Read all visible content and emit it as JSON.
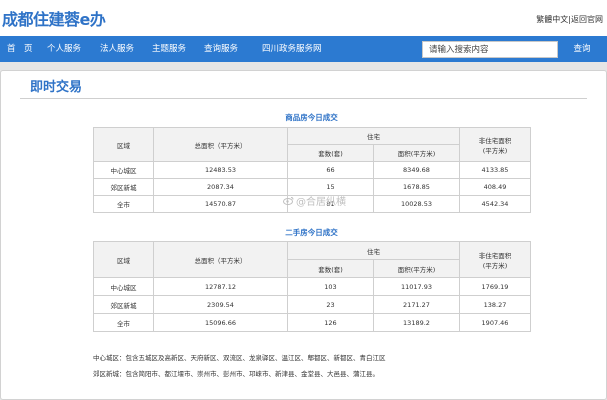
{
  "header": {
    "logo": "成都住建蓉e办",
    "lang_simplified": "繁體中文",
    "lang_sep": "|",
    "lang_home": "返回官网"
  },
  "nav": {
    "items": [
      "首　页",
      "个人服务",
      "法人服务",
      "主题服务",
      "查询服务",
      "四川政务服务网"
    ],
    "search_placeholder": "请输入搜索内容",
    "search_button": "查询"
  },
  "page": {
    "title": "即时交易"
  },
  "new_housing": {
    "title": "商品房今日成交",
    "headers": {
      "region": "区域",
      "total_area": "总面积（平方米）",
      "residential": "住宅",
      "units": "套数(套)",
      "area": "面积(平方米)",
      "non_residential_line1": "非住宅面积",
      "non_residential_line2": "(平方米)"
    },
    "rows": [
      {
        "region": "中心城区",
        "total": "12483.53",
        "units": "66",
        "area": "8349.68",
        "non": "4133.85"
      },
      {
        "region": "郊区新城",
        "total": "2087.34",
        "units": "15",
        "area": "1678.85",
        "non": "408.49"
      },
      {
        "region": "全市",
        "total": "14570.87",
        "units": "81",
        "area": "10028.53",
        "non": "4542.34"
      }
    ]
  },
  "second_hand": {
    "title": "二手房今日成交",
    "headers": {
      "region": "区域",
      "total_area": "总面积（平方米）",
      "residential": "住宅",
      "units": "套数(套)",
      "area": "面积(平方米)",
      "non_residential_line1": "非住宅面积",
      "non_residential_line2": "(平方米)"
    },
    "rows": [
      {
        "region": "中心城区",
        "total": "12787.12",
        "units": "103",
        "area": "11017.93",
        "non": "1769.19"
      },
      {
        "region": "郊区新城",
        "total": "2309.54",
        "units": "23",
        "area": "2171.27",
        "non": "138.27"
      },
      {
        "region": "全市",
        "total": "15096.66",
        "units": "126",
        "area": "13189.2",
        "non": "1907.46"
      }
    ]
  },
  "notes": {
    "central": "中心城区：包含五城区及高新区、天府新区、双流区、龙泉驿区、温江区、郫都区、新都区、青白江区",
    "suburban": "郊区新城：包含简阳市、都江堰市、崇州市、彭州市、邛崃市、新津县、金堂县、大邑县、蒲江县。"
  },
  "watermark": {
    "text": "@合居纵横"
  }
}
